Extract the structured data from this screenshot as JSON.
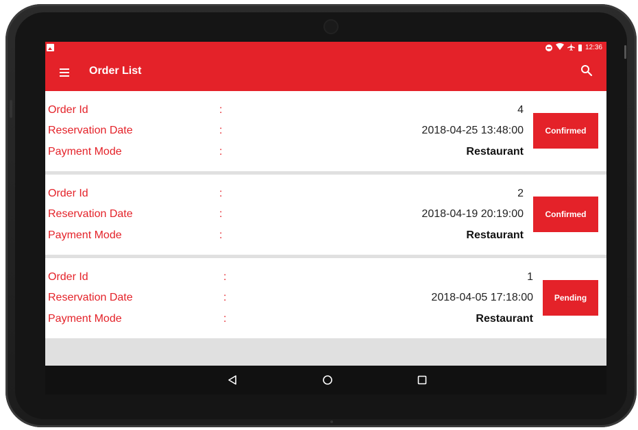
{
  "status_bar": {
    "time": "12:36",
    "icons": [
      "picture-icon",
      "do-not-disturb-icon",
      "wifi-icon",
      "airplane-icon",
      "battery-icon"
    ]
  },
  "app_bar": {
    "title": "Order List",
    "menu_icon": "hamburger-menu-icon",
    "search_icon": "search-icon"
  },
  "labels": {
    "order_id": "Order Id",
    "reservation_date": "Reservation Date",
    "payment_mode": "Payment Mode",
    "separator": ":"
  },
  "orders": [
    {
      "order_id": "4",
      "reservation_date": "2018-04-25 13:48:00",
      "payment_mode": "Restaurant",
      "status": "Confirmed"
    },
    {
      "order_id": "2",
      "reservation_date": "2018-04-19 20:19:00",
      "payment_mode": "Restaurant",
      "status": "Confirmed"
    },
    {
      "order_id": "1",
      "reservation_date": "2018-04-05 17:18:00",
      "payment_mode": "Restaurant",
      "status": "Pending"
    }
  ],
  "nav_bar": {
    "icons": [
      "back-icon",
      "home-icon",
      "recents-icon"
    ]
  },
  "colors": {
    "accent": "#e42229",
    "background": "#e0e0e0",
    "navbar": "#111111"
  }
}
